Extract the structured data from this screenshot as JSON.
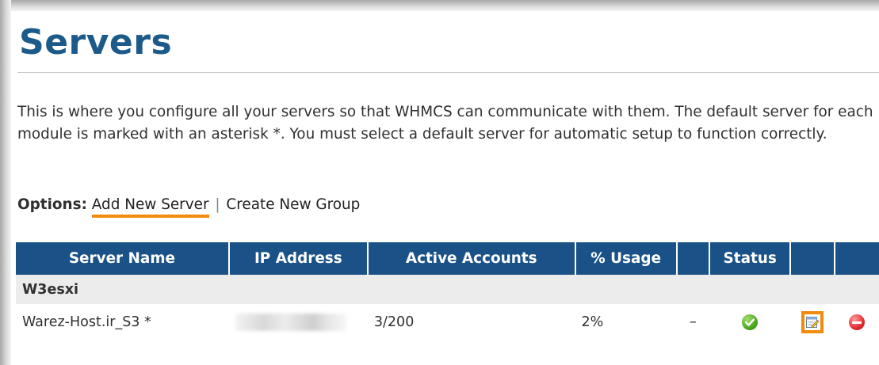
{
  "page": {
    "title": "Servers",
    "description": "This is where you configure all your servers so that WHMCS can communicate with them. The default server for each module is marked with an asterisk *. You must select a default server for automatic setup to function correctly."
  },
  "options": {
    "label": "Options:",
    "add_new_server": "Add New Server",
    "separator": "|",
    "create_new_group": "Create New Group"
  },
  "table": {
    "columns": [
      "Server Name",
      "IP Address",
      "Active Accounts",
      "% Usage",
      "",
      "Status",
      "",
      ""
    ],
    "groups": [
      {
        "name": "W3esxi",
        "servers": [
          {
            "name": "Warez-Host.ir_S3 *",
            "ip_address": "",
            "active_accounts": "3/200",
            "usage": "2%",
            "extra": "–",
            "status_icon": "check-circle-icon",
            "edit_icon": "edit-icon",
            "delete_icon": "delete-icon"
          }
        ]
      }
    ]
  },
  "colors": {
    "title": "#1c5a8a",
    "header_bg": "#1a5187",
    "highlight": "#f28b0c",
    "group_bg": "#ececec"
  }
}
